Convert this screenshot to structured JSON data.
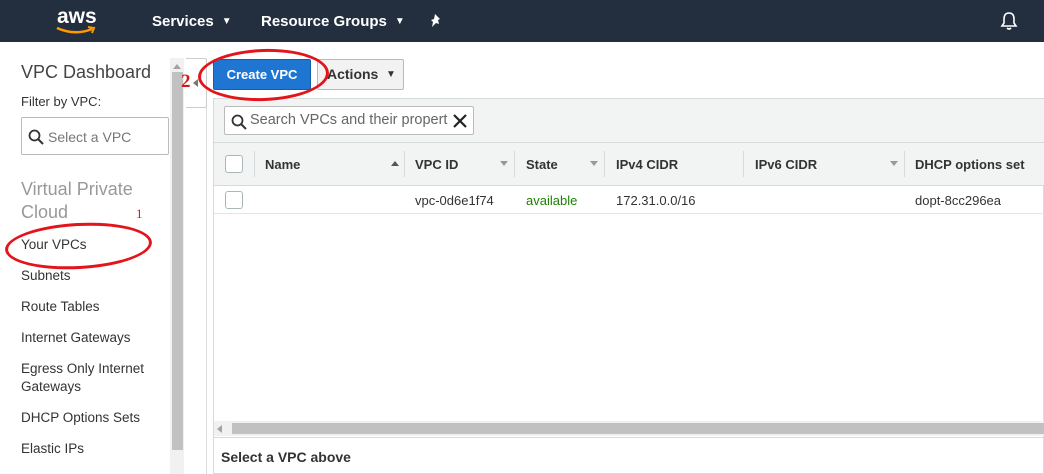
{
  "topnav": {
    "logo_text": "aws",
    "services_label": "Services",
    "resource_groups_label": "Resource Groups",
    "pin_icon": "pin-icon",
    "bell_icon": "bell-icon",
    "background": "#232f3e"
  },
  "sidebar": {
    "title": "VPC Dashboard",
    "filter_label": "Filter by VPC:",
    "filter_placeholder": "Select a VPC",
    "section_heading": "Virtual Private Cloud",
    "items": [
      {
        "label": "Your VPCs"
      },
      {
        "label": "Subnets"
      },
      {
        "label": "Route Tables"
      },
      {
        "label": "Internet Gateways"
      },
      {
        "label": "Egress Only Internet Gateways"
      },
      {
        "label": "DHCP Options Sets"
      },
      {
        "label": "Elastic IPs"
      }
    ]
  },
  "toolbar": {
    "create_label": "Create VPC",
    "actions_label": "Actions",
    "primary_color": "#1e76d2"
  },
  "search": {
    "placeholder": "Search VPCs and their properties"
  },
  "table": {
    "columns": [
      "Name",
      "VPC ID",
      "State",
      "IPv4 CIDR",
      "IPv6 CIDR",
      "DHCP options set"
    ],
    "rows": [
      {
        "name": "",
        "vpc_id": "vpc-0d6e1f74",
        "state": "available",
        "ipv4": "172.31.0.0/16",
        "ipv6": "",
        "dhcp": "dopt-8cc296ea"
      }
    ],
    "state_color": "#1d8102"
  },
  "footer": {
    "text": "Select a VPC above"
  },
  "annotations": {
    "step1": "1",
    "step2": "2",
    "color": "#e3141b"
  }
}
